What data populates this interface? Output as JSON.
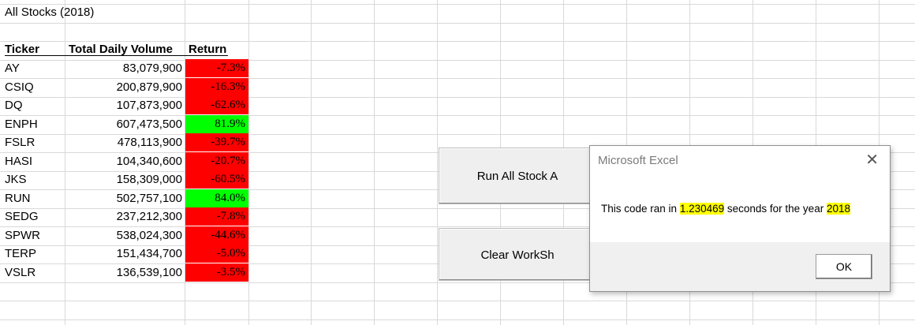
{
  "sheet": {
    "title": "All Stocks (2018)",
    "headers": {
      "ticker": "Ticker",
      "volume": "Total Daily Volume",
      "return": "Return"
    },
    "rows": [
      {
        "ticker": "AY",
        "volume": "83,079,900",
        "return": "-7.3%",
        "positive": false
      },
      {
        "ticker": "CSIQ",
        "volume": "200,879,900",
        "return": "-16.3%",
        "positive": false
      },
      {
        "ticker": "DQ",
        "volume": "107,873,900",
        "return": "-62.6%",
        "positive": false
      },
      {
        "ticker": "ENPH",
        "volume": "607,473,500",
        "return": "81.9%",
        "positive": true
      },
      {
        "ticker": "FSLR",
        "volume": "478,113,900",
        "return": "-39.7%",
        "positive": false
      },
      {
        "ticker": "HASI",
        "volume": "104,340,600",
        "return": "-20.7%",
        "positive": false
      },
      {
        "ticker": "JKS",
        "volume": "158,309,000",
        "return": "-60.5%",
        "positive": false
      },
      {
        "ticker": "RUN",
        "volume": "502,757,100",
        "return": "84.0%",
        "positive": true
      },
      {
        "ticker": "SEDG",
        "volume": "237,212,300",
        "return": "-7.8%",
        "positive": false
      },
      {
        "ticker": "SPWR",
        "volume": "538,024,300",
        "return": "-44.6%",
        "positive": false
      },
      {
        "ticker": "TERP",
        "volume": "151,434,700",
        "return": "-5.0%",
        "positive": false
      },
      {
        "ticker": "VSLR",
        "volume": "136,539,100",
        "return": "-3.5%",
        "positive": false
      }
    ],
    "colors": {
      "negative": "#ff0000",
      "positive": "#00ff00"
    }
  },
  "buttons": {
    "run_label": "Run All Stock A",
    "clear_label": "Clear WorkSh"
  },
  "dialog": {
    "title": "Microsoft Excel",
    "close_icon": "close-icon",
    "message_prefix": "This code ran in ",
    "seconds": "1.230469",
    "message_middle": " seconds for the year ",
    "year": "2018",
    "ok_label": "OK",
    "highlight_color": "#ffff00"
  }
}
